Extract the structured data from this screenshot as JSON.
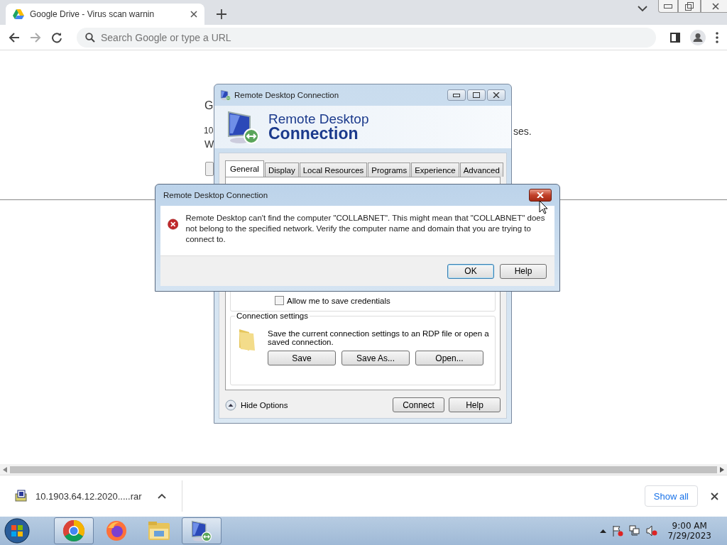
{
  "browser": {
    "tab": {
      "title": "Google Drive - Virus scan warnin",
      "selected": true
    },
    "address_bar": {
      "placeholder": "Search Google or type a URL"
    }
  },
  "page": {
    "heading": "G",
    "line_1_start": "10",
    "line_1_end": "ses.",
    "line_2_start": "W"
  },
  "rdp_window": {
    "title": "Remote Desktop Connection",
    "banner_line_1": "Remote Desktop",
    "banner_line_2": "Connection",
    "tabs": [
      {
        "label": "General",
        "selected": true
      },
      {
        "label": "Display",
        "selected": false
      },
      {
        "label": "Local Resources",
        "selected": false
      },
      {
        "label": "Programs",
        "selected": false
      },
      {
        "label": "Experience",
        "selected": false
      },
      {
        "label": "Advanced",
        "selected": false
      }
    ],
    "credentials_checkbox": {
      "label": "Allow me to save credentials",
      "checked": false
    },
    "connection_settings": {
      "legend": "Connection settings",
      "description": "Save the current connection settings to an RDP file or open a saved connection.",
      "buttons": [
        "Save",
        "Save As...",
        "Open..."
      ]
    },
    "hide_options": "Hide Options",
    "buttons": [
      "Connect",
      "Help"
    ]
  },
  "error_dialog": {
    "title": "Remote Desktop Connection",
    "message": "Remote Desktop can't find the computer \"COLLABNET\". This might mean that \"COLLABNET\" does not belong to the specified network.  Verify the computer name and domain that you are trying to connect to.",
    "buttons": [
      "OK",
      "Help"
    ]
  },
  "downloads": {
    "file_name": "10.1903.64.12.2020.....rar",
    "show_all": "Show all"
  },
  "taskbar": {
    "apps": [
      {
        "kind": "chrome",
        "open": true
      },
      {
        "kind": "firefox",
        "open": false
      },
      {
        "kind": "explorer",
        "open": false
      },
      {
        "kind": "rdp",
        "open": true
      }
    ],
    "time": "9:00 AM",
    "date": "7/29/2023"
  }
}
